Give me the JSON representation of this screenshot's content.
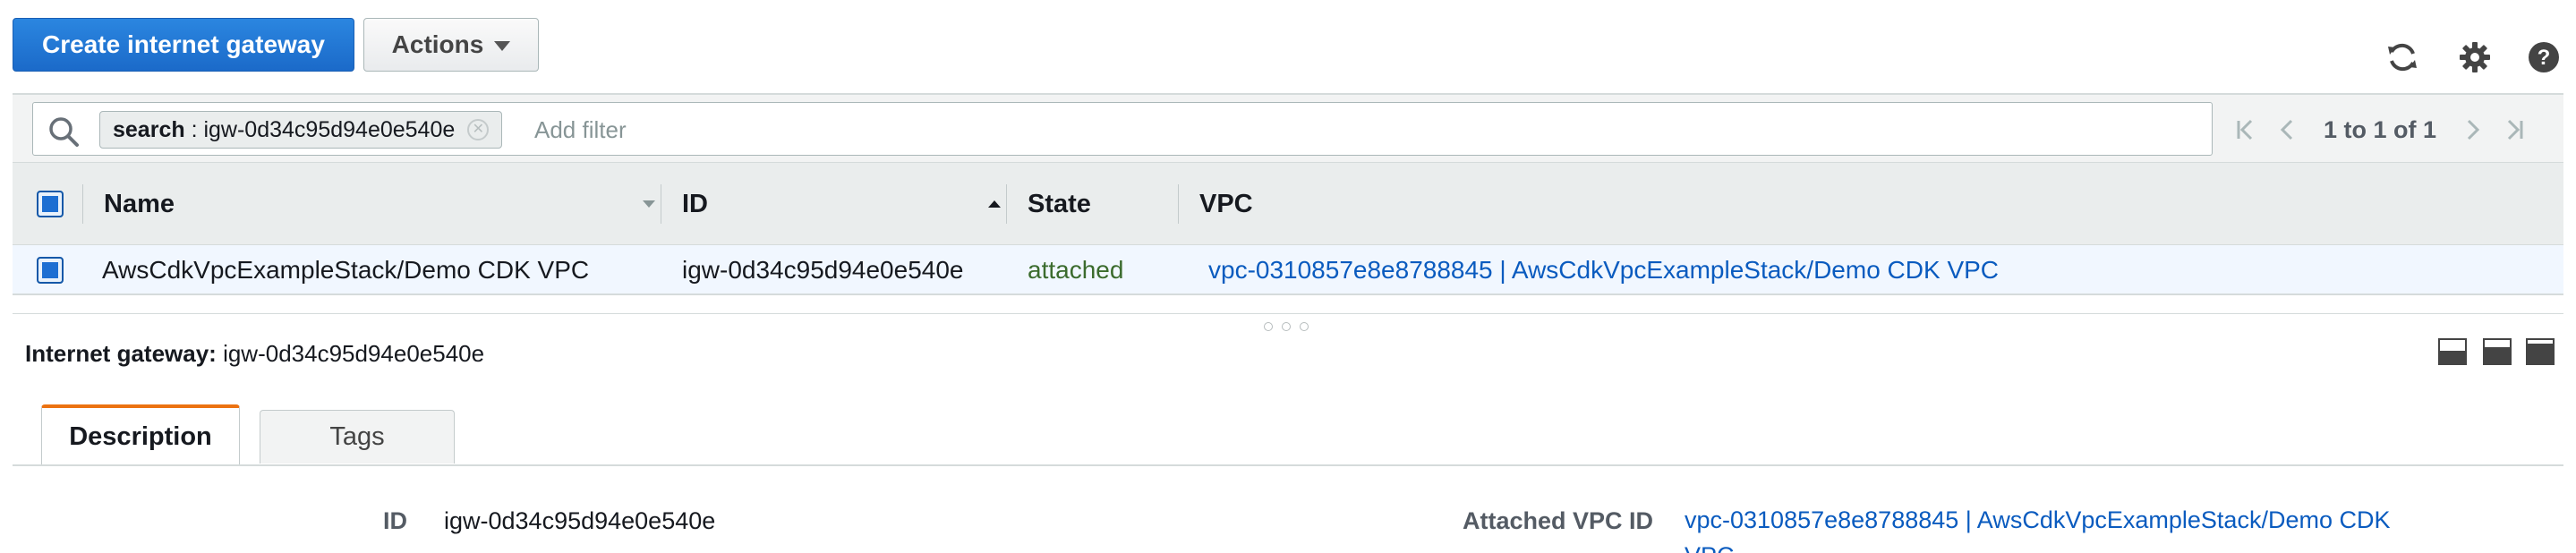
{
  "toolbar": {
    "create_label": "Create internet gateway",
    "actions_label": "Actions"
  },
  "filter": {
    "token_key": "search",
    "token_sep": " : ",
    "token_value": "igw-0d34c95d94e0e540e",
    "placeholder": "Add filter",
    "pagination": "1 to 1 of 1"
  },
  "table": {
    "columns": [
      "Name",
      "ID",
      "State",
      "VPC"
    ],
    "rows": [
      {
        "name": "AwsCdkVpcExampleStack/Demo CDK VPC",
        "id": "igw-0d34c95d94e0e540e",
        "state": "attached",
        "vpc": "vpc-0310857e8e8788845 | AwsCdkVpcExampleStack/Demo CDK VPC"
      }
    ]
  },
  "details": {
    "heading_label": "Internet gateway:",
    "heading_value": "igw-0d34c95d94e0e540e",
    "tabs": [
      "Description",
      "Tags"
    ],
    "id_label": "ID",
    "id_value": "igw-0d34c95d94e0e540e",
    "vpc_label": "Attached VPC ID",
    "vpc_value": "vpc-0310857e8e8788845 | AwsCdkVpcExampleStack/Demo CDK",
    "vpc_value_wrap": "VPC"
  },
  "colors": {
    "primary": "#1b6ac9",
    "link": "#0a5bbf",
    "state_attached": "#3b6b2d",
    "tab_accent": "#ec7211",
    "selected_row": "#f1f7ff"
  },
  "icons": [
    "refresh-icon",
    "gear-icon",
    "help-icon",
    "search-icon",
    "first-page-icon",
    "prev-page-icon",
    "next-page-icon",
    "last-page-icon",
    "layout-bottom-icon",
    "layout-split-icon",
    "layout-top-icon"
  ]
}
